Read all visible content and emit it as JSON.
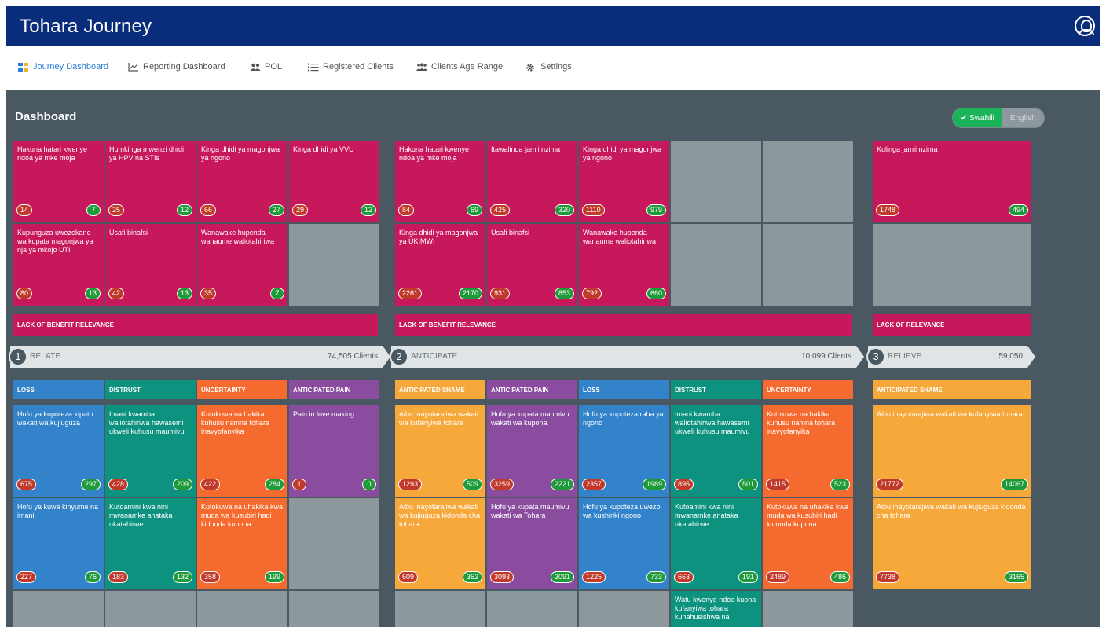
{
  "app": {
    "title": "Tohara Journey"
  },
  "nav": [
    {
      "label": "Journey Dashboard",
      "icon": "dashboard-grid-icon"
    },
    {
      "label": "Reporting Dashboard",
      "icon": "line-chart-icon"
    },
    {
      "label": "POL",
      "icon": "users-icon"
    },
    {
      "label": "Registered Clients",
      "icon": "list-icon"
    },
    {
      "label": "Clients Age Range",
      "icon": "group-icon"
    },
    {
      "label": "Settings",
      "icon": "gear-icon"
    }
  ],
  "dashboard": {
    "heading": "Dashboard",
    "lang_swahili": "✔ Swahili",
    "lang_english": "English",
    "relate_top": [
      {
        "text": "Hakuna hatari kwenye ndoa ya mke moja",
        "a": "14",
        "b": "7"
      },
      {
        "text": "Humkinga mwenzi dhidi ya HPV na STIs",
        "a": "25",
        "b": "12"
      },
      {
        "text": "Kinga dhidi ya magonjwa ya ngono",
        "a": "66",
        "b": "27"
      },
      {
        "text": "Kinga dhidi ya VVU",
        "a": "29",
        "b": "12"
      },
      {
        "text": "Kupunguza uwezekano wa kupata magonjwa ya nja ya mkojo UTI",
        "a": "80",
        "b": "13"
      },
      {
        "text": "Usafi binafsi",
        "a": "42",
        "b": "13"
      },
      {
        "text": "Wanawake hupenda wanaume waliotahiriwa",
        "a": "35",
        "b": "7"
      }
    ],
    "anticipate_top": [
      {
        "text": "Hakuna hatari kwenye ndoa ya mke moja",
        "a": "84",
        "b": "69"
      },
      {
        "text": "Itawalinda jamii nzima",
        "a": "425",
        "b": "320"
      },
      {
        "text": "Kinga dhidi ya magonjwa ya ngono",
        "a": "1110",
        "b": "979"
      },
      {
        "text": "Kinga dhidi ya magonjwa ya UKIMWI",
        "a": "2261",
        "b": "2170"
      },
      {
        "text": "Usafi binafsi",
        "a": "931",
        "b": "853"
      },
      {
        "text": "Wanawake hupenda wanaume waliotahiriwa",
        "a": "792",
        "b": "660"
      }
    ],
    "relieve_top": [
      {
        "text": "Kulinga jamii nzima",
        "a": "1748",
        "b": "494"
      }
    ],
    "bars": {
      "relate": "LACK OF BENEFIT RELEVANCE",
      "anticipate": "LACK OF BENEFIT RELEVANCE",
      "relieve": "LACK OF RELEVANCE"
    },
    "stages": [
      {
        "num": "1",
        "name": "RELATE",
        "clients": "74,505 Clients"
      },
      {
        "num": "2",
        "name": "ANTICIPATE",
        "clients": "10,099 Clients"
      },
      {
        "num": "3",
        "name": "RELIEVE",
        "clients": "59,050"
      }
    ],
    "relate_headers": [
      "LOSS",
      "DISTRUST",
      "UNCERTAINTY",
      "ANTICIPATED PAIN"
    ],
    "anticipate_headers": [
      "ANTICIPATED SHAME",
      "ANTICIPATED PAIN",
      "LOSS",
      "DISTRUST",
      "UNCERTAINTY"
    ],
    "relieve_headers": [
      "ANTICIPATED SHAME"
    ],
    "relate_bottom": [
      {
        "text": "Hofu ya kupoteza kipato wakati wa kujiuguza",
        "a": "675",
        "b": "297"
      },
      {
        "text": "Imani kwamba waliotahiriwa hawasemi ukweli kuhusu maumivu",
        "a": "428",
        "b": "209"
      },
      {
        "text": "Kutokuwa na hakika kuhusu namna tohara inavyofanyika",
        "a": "422",
        "b": "284"
      },
      {
        "text": "Pain in love making",
        "a": "1",
        "b": "0"
      },
      {
        "text": "Hofu ya kuwa kinyume na imani",
        "a": "227",
        "b": "76"
      },
      {
        "text": "Kutoamini kwa nini mwanamke anataka ukatahirwe",
        "a": "183",
        "b": "132"
      },
      {
        "text": "Kutokuwa na uhakika kwa muda wa kusubiri hadi kidonda kupona",
        "a": "358",
        "b": "199"
      }
    ],
    "anticipate_bottom": [
      {
        "text": "Aibu inayotarajiwa wakati wa kufanyiwa tohara",
        "a": "1293",
        "b": "509"
      },
      {
        "text": "Hofu ya kupata maumivu wakati wa kupona",
        "a": "3259",
        "b": "2221"
      },
      {
        "text": "Hofu ya kupoteza raha ya ngono",
        "a": "2357",
        "b": "1989"
      },
      {
        "text": "Imani kwamba waliotahiriwa hawasemi ukweli kuhusu maumivu",
        "a": "895",
        "b": "501"
      },
      {
        "text": "Kutokuwa na hakika kuhusu namna tohara inavyofanyika",
        "a": "1415",
        "b": "523"
      },
      {
        "text": "Aibu inayotarajiwa wakati wa kujiuguza kidonda cha tohara",
        "a": "609",
        "b": "352"
      },
      {
        "text": "Hofu ya kupata maumivu wakati wa Tohara",
        "a": "3093",
        "b": "2091"
      },
      {
        "text": "Hofu ya kupoteza uwezo wa kushiriki ngono",
        "a": "1225",
        "b": "733"
      },
      {
        "text": "Kutoamini kwa nini mwanamke anataka ukatahirwe",
        "a": "663",
        "b": "191"
      },
      {
        "text": "Kutokuwa na uhakika kwa muda wa kusubiri hadi kidonda kupona",
        "a": "2489",
        "b": "486"
      },
      {
        "text": "Watu kwenye ndoa kuona kufanyiwa tohara kunahusishwa na",
        "a": "",
        "b": ""
      }
    ],
    "relieve_bottom": [
      {
        "text": "Aibu inayotarajiwa wakati wa kufanyiwa tohara",
        "a": "21772",
        "b": "14067"
      },
      {
        "text": "Aibu inayotarajiwa wakati wa kujiuguza kidonda cha tohara",
        "a": "7738",
        "b": "3165"
      }
    ]
  }
}
